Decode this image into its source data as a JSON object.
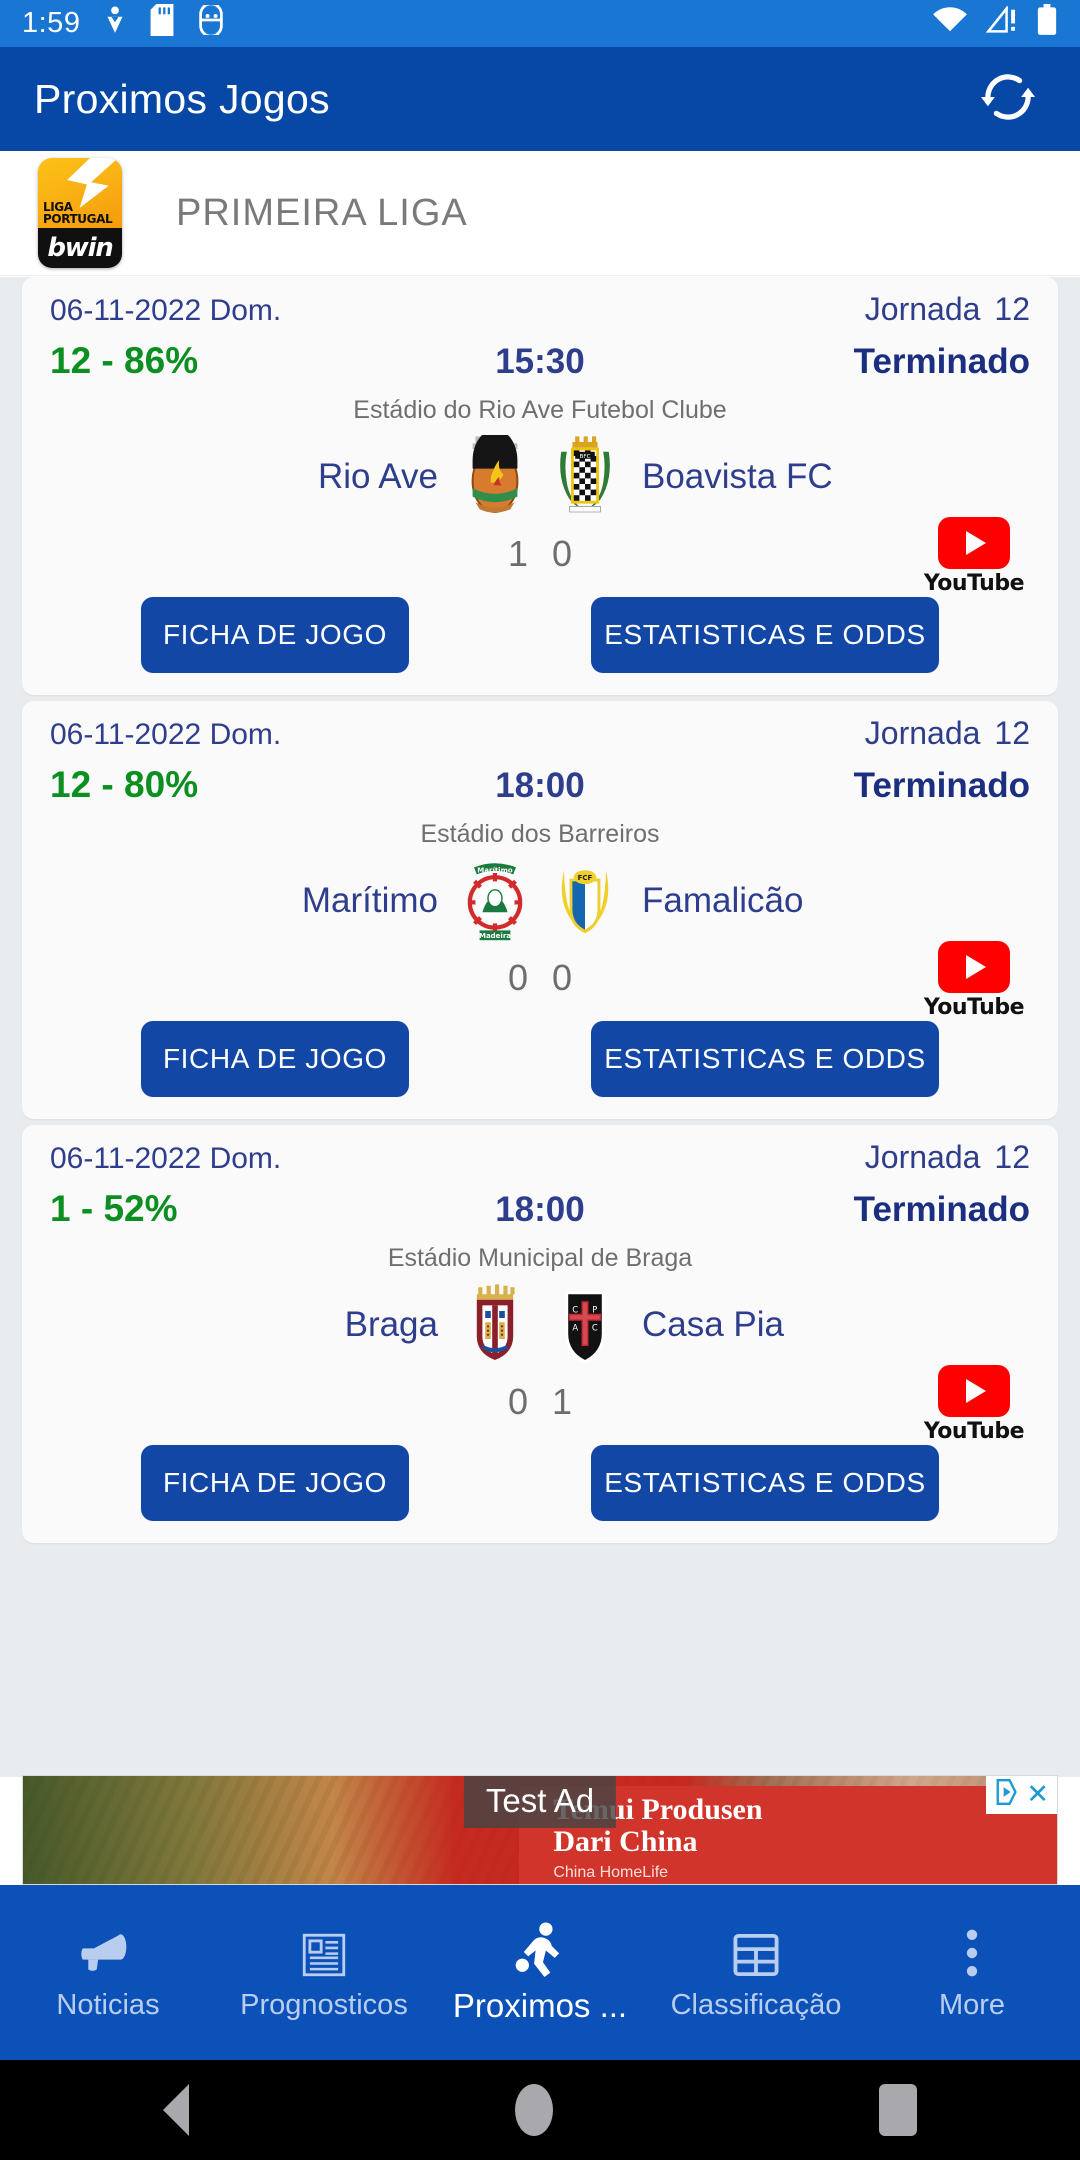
{
  "status_bar": {
    "clock": "1:59",
    "icons_left": [
      "downloads-icon",
      "sd-card-icon",
      "android-debug-icon"
    ],
    "icons_right": [
      "wifi-icon",
      "cellular-warning-icon",
      "battery-icon"
    ]
  },
  "app_bar": {
    "title": "Proximos Jogos",
    "refresh_icon": "refresh-icon",
    "background": "#0747a6"
  },
  "league_header": {
    "name": "PRIMEIRA LIGA",
    "logo_line1": "LIGA",
    "logo_line2": "PORTUGAL",
    "logo_brand": "bwin"
  },
  "labels": {
    "jornada": "Jornada",
    "ficha_button": "FICHA DE JOGO",
    "stats_button": "ESTATISTICAS E ODDS",
    "youtube": "YouTube"
  },
  "matches": [
    {
      "date": "06-11-2022 Dom.",
      "round": "12",
      "percent": "12 - 86%",
      "kickoff": "15:30",
      "state": "Terminado",
      "venue": "Estádio do Rio Ave Futebol Clube",
      "home_team": "Rio Ave",
      "away_team": "Boavista FC",
      "home_score": "1",
      "away_score": "0"
    },
    {
      "date": "06-11-2022 Dom.",
      "round": "12",
      "percent": "12 - 80%",
      "kickoff": "18:00",
      "state": "Terminado",
      "venue": "Estádio dos Barreiros",
      "home_team": "Marítimo",
      "away_team": "Famalicão",
      "home_score": "0",
      "away_score": "0"
    },
    {
      "date": "06-11-2022 Dom.",
      "round": "12",
      "percent": "1 - 52%",
      "kickoff": "18:00",
      "state": "Terminado",
      "venue": "Estádio Municipal de Braga",
      "home_team": "Braga",
      "away_team": "Casa Pia",
      "home_score": "0",
      "away_score": "1"
    }
  ],
  "ad": {
    "test_label": "Test Ad",
    "headline_line1": "Temui Produsen",
    "headline_line2": "Dari China",
    "sub": "China HomeLife",
    "close_label": "✕"
  },
  "bottom_nav": {
    "items": [
      {
        "label": "Noticias",
        "icon": "megaphone-icon",
        "active": false
      },
      {
        "label": "Prognosticos",
        "icon": "newspaper-icon",
        "active": false
      },
      {
        "label": "Proximos ...",
        "icon": "soccer-player-icon",
        "active": true
      },
      {
        "label": "Classificação",
        "icon": "table-grid-icon",
        "active": false
      },
      {
        "label": "More",
        "icon": "overflow-dots-icon",
        "active": false
      }
    ]
  },
  "android_nav": {
    "back": "back-button",
    "home": "home-button",
    "recents": "recents-button"
  },
  "colors": {
    "primary": "#0747a6",
    "status_bar": "#1976d2",
    "accent_green": "#0a8f20",
    "text_blue": "#2f3e8c",
    "nav_bar": "#0c51b8"
  }
}
